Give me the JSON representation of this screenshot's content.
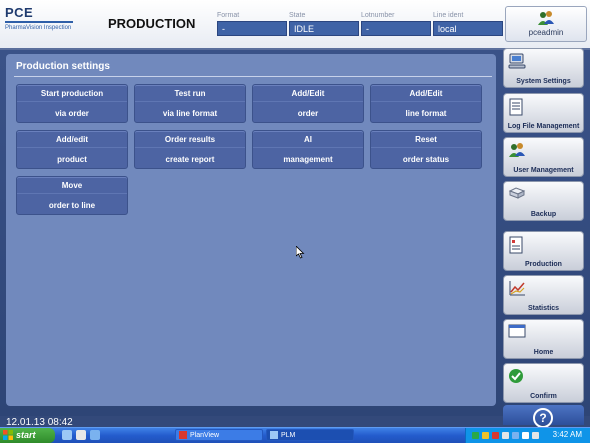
{
  "header": {
    "logo_text": "PCE",
    "logo_subtext": "PharmaVision Inspection",
    "page_title": "PRODUCTION",
    "fields": [
      {
        "label": "Format",
        "value": "-"
      },
      {
        "label": "State",
        "value": "IDLE"
      },
      {
        "label": "Lotnumber",
        "value": "-"
      },
      {
        "label": "Line ident",
        "value": "local"
      }
    ],
    "user": {
      "name": "pceadmin",
      "icon": "users-icon"
    }
  },
  "panel": {
    "title": "Production settings",
    "tiles": [
      {
        "top": "Start production",
        "bottom": "via order"
      },
      {
        "top": "Test run",
        "bottom": "via line format"
      },
      {
        "top": "Add/Edit",
        "bottom": "order"
      },
      {
        "top": "Add/Edit",
        "bottom": "line format"
      },
      {
        "top": "Add/edit",
        "bottom": "product"
      },
      {
        "top": "Order results",
        "bottom": "create report"
      },
      {
        "top": "AI",
        "bottom": "management"
      },
      {
        "top": "Reset",
        "bottom": "order status"
      },
      {
        "top": "Move",
        "bottom": "order to line"
      }
    ]
  },
  "sidebar": {
    "items": [
      {
        "label": "System Settings",
        "icon": "computer-icon"
      },
      {
        "label": "Log File Management",
        "icon": "log-file-icon"
      },
      {
        "label": "User Management",
        "icon": "users-icon"
      },
      {
        "label": "Backup",
        "icon": "backup-icon"
      },
      {
        "label": "Production",
        "icon": "document-icon"
      },
      {
        "label": "Statistics",
        "icon": "chart-icon"
      },
      {
        "label": "Home",
        "icon": "window-icon"
      },
      {
        "label": "Confirm",
        "icon": "check-icon"
      }
    ],
    "help_icon": "help-icon",
    "help_glyph": "?"
  },
  "status": {
    "datetime": "12.01.13 08:42"
  },
  "taskbar": {
    "start_label": "start",
    "tasks": [
      {
        "label": "PlanView"
      },
      {
        "label": "PLM"
      }
    ],
    "clock": "3:42 AM"
  },
  "colors": {
    "accent": "#3f63a6",
    "panel": "#7189bd",
    "tile": "#4d64a3",
    "taskbar": "#245ccd",
    "start": "#2f8b2a"
  }
}
